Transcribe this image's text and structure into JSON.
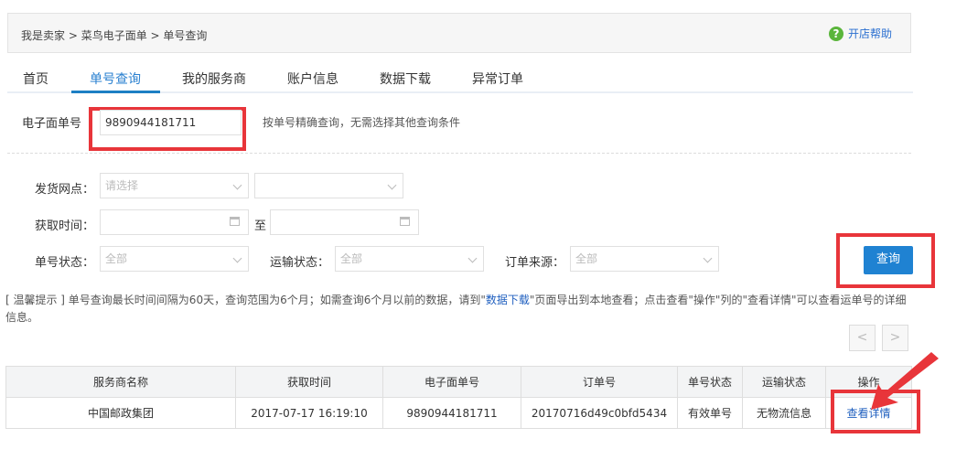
{
  "breadcrumb": {
    "items": [
      "我是卖家",
      "菜鸟电子面单",
      "单号查询"
    ],
    "separator": " > "
  },
  "help": {
    "label": "开店帮助",
    "icon": "help-circle-icon"
  },
  "tabs": [
    {
      "label": "首页",
      "active": false
    },
    {
      "label": "单号查询",
      "active": true
    },
    {
      "label": "我的服务商",
      "active": false
    },
    {
      "label": "账户信息",
      "active": false
    },
    {
      "label": "数据下载",
      "active": false
    },
    {
      "label": "异常订单",
      "active": false
    }
  ],
  "waybill": {
    "label": "电子面单号",
    "value": "9890944181711",
    "hint": "按单号精确查询，无需选择其他查询条件"
  },
  "filters": {
    "site_label": "发货网点：",
    "site_placeholder": "请选择",
    "site2_value": "",
    "time_label": "获取时间：",
    "to_label": "至",
    "status_label": "单号状态：",
    "status_value": "全部",
    "ship_label": "运输状态：",
    "ship_value": "全部",
    "source_label": "订单来源：",
    "source_value": "全部"
  },
  "query_button": "查询",
  "notice": {
    "before": "[ 温馨提示 ] 单号查询最长时间间隔为60天，查询范围为6个月；如需查询6个月以前的数据，请到\"",
    "link": "数据下载",
    "after": "\"页面导出到本地查看；点击查看\"操作\"列的\"查看详情\"可以查看运单号的详细信息。"
  },
  "pager": {
    "prev": "<",
    "next": ">"
  },
  "table": {
    "headers": [
      "服务商名称",
      "获取时间",
      "电子面单号",
      "订单号",
      "单号状态",
      "运输状态",
      "操作"
    ],
    "rows": [
      {
        "provider": "中国邮政集团",
        "time": "2017-07-17 16:19:10",
        "waybill": "9890944181711",
        "order": "20170716d49c0bfd5434",
        "status": "有效单号",
        "transport": "无物流信息",
        "action": "查看详情"
      }
    ]
  },
  "colors": {
    "accent": "#1f82d2",
    "highlight": "#e8353a",
    "help": "#5ab53b"
  }
}
